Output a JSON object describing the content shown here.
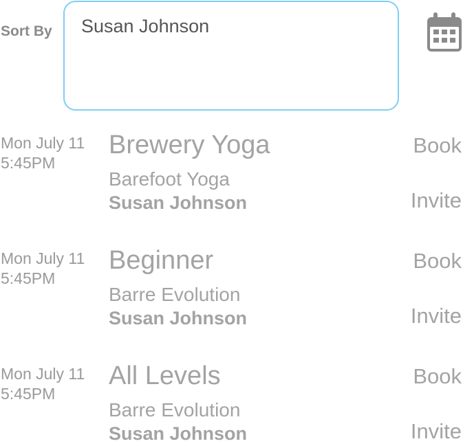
{
  "header": {
    "sort_label": "Sort By",
    "filter_value": "Susan Johnson",
    "calendar_icon": "calendar-icon"
  },
  "sessions": [
    {
      "date": "Mon July 11",
      "time": "5:45PM",
      "title": "Brewery Yoga",
      "studio": "Barefoot Yoga",
      "instructor": "Susan Johnson",
      "book_label": "Book",
      "invite_label": "Invite"
    },
    {
      "date": "Mon July 11",
      "time": "5:45PM",
      "title": "Beginner",
      "studio": "Barre Evolution",
      "instructor": "Susan Johnson",
      "book_label": "Book",
      "invite_label": "Invite"
    },
    {
      "date": "Mon July 11",
      "time": "5:45PM",
      "title": "All Levels",
      "studio": "Barre Evolution",
      "instructor": "Susan Johnson",
      "book_label": "Book",
      "invite_label": "Invite"
    }
  ],
  "colors": {
    "text_gray": "#a3a3a3",
    "box_border": "#7ecff3",
    "icon_gray": "#8a8a8a"
  }
}
